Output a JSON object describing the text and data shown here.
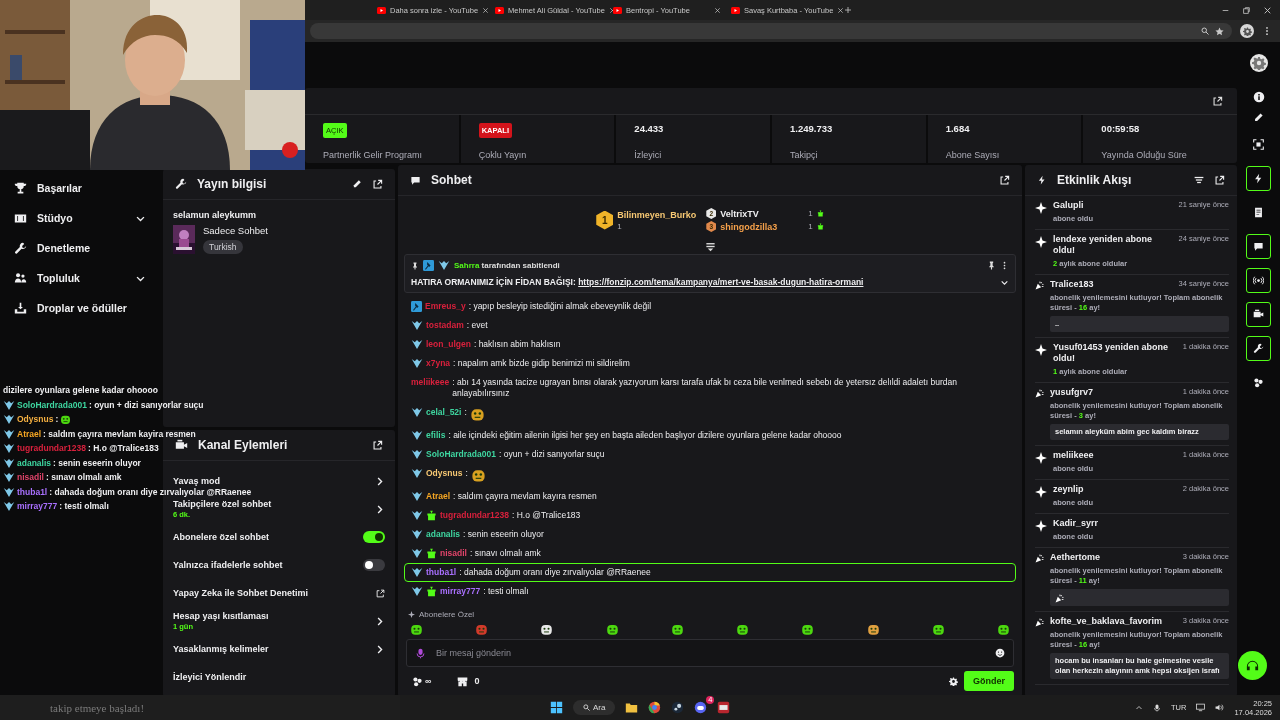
{
  "browser": {
    "tabs": [
      {
        "title": "Daha sonra izle - YouTube"
      },
      {
        "title": "Mehmet Ali Güldal - YouTube"
      },
      {
        "title": "Bentropi - YouTube"
      },
      {
        "title": "Savaş Kurtbaba - YouTube"
      }
    ]
  },
  "stats": {
    "cells": [
      {
        "kind": "badge",
        "badge": "AÇIK",
        "on": true,
        "label": "Partnerlik Gelir Programı"
      },
      {
        "kind": "badge",
        "badge": "KAPALI",
        "on": false,
        "label": "Çoklu Yayın"
      },
      {
        "kind": "value",
        "value": "24.433",
        "label": "İzleyici"
      },
      {
        "kind": "value",
        "value": "1.249.733",
        "label": "Takipçi"
      },
      {
        "kind": "value",
        "value": "1.684",
        "label": "Abone Sayısı"
      },
      {
        "kind": "value",
        "value": "00:59:58",
        "label": "Yayında Olduğu Süre"
      }
    ]
  },
  "sidebar": {
    "items": [
      {
        "label": "Başarılar",
        "expandable": false
      },
      {
        "label": "Stüdyo",
        "expandable": true
      },
      {
        "label": "Denetleme",
        "expandable": false
      },
      {
        "label": "Topluluk",
        "expandable": true
      },
      {
        "label": "Droplar ve ödüller",
        "expandable": false
      }
    ]
  },
  "stream_info": {
    "title": "Yayın bilgisi",
    "stream_title": "selamun aleykumm",
    "category": "Sadece Sohbet",
    "tags": [
      "Turkish"
    ]
  },
  "channel_actions": {
    "title": "Kanal Eylemleri",
    "items": [
      {
        "kind": "arrow",
        "label": "Yavaş mod"
      },
      {
        "kind": "arrow",
        "label": "Takipçilere özel sohbet",
        "value": "6 dk."
      },
      {
        "kind": "toggle",
        "label": "Abonelere özel sohbet",
        "on": true
      },
      {
        "kind": "toggle",
        "label": "Yalnızca ifadelerle sohbet",
        "on": false
      },
      {
        "kind": "external",
        "label": "Yapay Zeka ile Sohbet Denetimi"
      },
      {
        "kind": "arrow",
        "label": "Hesap yaşı kısıtlaması",
        "value": "1 gün"
      },
      {
        "kind": "arrow",
        "label": "Yasaklanmış kelimeler"
      },
      {
        "kind": "plain",
        "label": "İzleyici Yönlendir"
      }
    ]
  },
  "chat": {
    "title": "Sohbet",
    "separator": ":",
    "leaderboard": [
      {
        "rank": "1",
        "name": "Bilinmeyen_Burko",
        "count": "1"
      },
      {
        "rank": "2",
        "name": "VeltrixTV",
        "count": "1"
      },
      {
        "rank": "3",
        "name": "shingodzilla3",
        "count": "1"
      }
    ],
    "pinned": {
      "pinned_by": "Sahrra",
      "note": "tarafından sabitlendi",
      "text": "HATIRA ORMANIMIZ İÇİN FİDAN BAĞIŞI:",
      "link": "https://fonzip.com/tema/kampanya/mert-ve-basak-dugun-hatira-ormani"
    },
    "messages": [
      {
        "kind": "text",
        "moderator": true,
        "subscriber": false,
        "gifter": false,
        "user": "Emreus_y",
        "color": "#d8203c",
        "text": "yapıp besleyip istediğini almak ebeveynlik değil",
        "highlighted": false
      },
      {
        "kind": "text",
        "moderator": false,
        "subscriber": true,
        "gifter": false,
        "user": "tostadam",
        "color": "#d8203c",
        "text": "evet",
        "highlighted": false
      },
      {
        "kind": "text",
        "moderator": false,
        "subscriber": true,
        "gifter": false,
        "user": "leon_ulgen",
        "color": "#d8203c",
        "text": "haklısın abim haklısın",
        "highlighted": false
      },
      {
        "kind": "text",
        "moderator": false,
        "subscriber": true,
        "gifter": false,
        "user": "x7yna",
        "color": "#d8203c",
        "text": "napalım amk bizde gidip benimizi mi sildirelim",
        "highlighted": false
      },
      {
        "kind": "text",
        "moderator": false,
        "subscriber": false,
        "gifter": false,
        "user": "meliikeee",
        "color": "#d8203c",
        "text": "abı 14 yasında tacize ugrayan bınsı olarak yazıyorum karsı tarafa ufak bı ceza bile venlmedı sebebı de yetersız delıldi adaletı burdan anlayabılırsınız",
        "highlighted": false
      },
      {
        "kind": "emote",
        "moderator": false,
        "subscriber": true,
        "gifter": false,
        "user": "celal_52i",
        "color": "#3ed6a0",
        "highlighted": false
      },
      {
        "kind": "text",
        "moderator": false,
        "subscriber": true,
        "gifter": false,
        "user": "efilis",
        "color": "#3ed6a0",
        "text": "aile içindeki eğitim ailenin ilgisi her şey en başta aileden başlıyor dizilere oyunlara gelene kadar ohoooo",
        "highlighted": false
      },
      {
        "kind": "text",
        "moderator": false,
        "subscriber": true,
        "gifter": false,
        "user": "SoloHardrada001",
        "color": "#3ed6a0",
        "text": "oyun + dizi sanıyorlar suçu",
        "highlighted": false
      },
      {
        "kind": "emote",
        "moderator": false,
        "subscriber": true,
        "gifter": false,
        "user": "Odysnus",
        "color": "#f7c873",
        "highlighted": false
      },
      {
        "kind": "text",
        "moderator": false,
        "subscriber": true,
        "gifter": false,
        "user": "Atrael",
        "color": "#f5a623",
        "text": "saldım çayıra mevlam kayıra resmen",
        "highlighted": false
      },
      {
        "kind": "text",
        "moderator": false,
        "subscriber": true,
        "gifter": true,
        "user": "tugradundar1238",
        "color": "#d8203c",
        "text": "H.o @Tralice183",
        "highlighted": false
      },
      {
        "kind": "text",
        "moderator": false,
        "subscriber": true,
        "gifter": false,
        "user": "adanalis",
        "color": "#3ed6a0",
        "text": "senin eseerin oluyor",
        "highlighted": false
      },
      {
        "kind": "text",
        "moderator": false,
        "subscriber": true,
        "gifter": true,
        "user": "nisadil",
        "color": "#e0446a",
        "text": "sınavı olmalı amk",
        "highlighted": false
      },
      {
        "kind": "text",
        "moderator": false,
        "subscriber": true,
        "gifter": false,
        "user": "thuba1l",
        "color": "#a970ff",
        "text": "dahada doğum oranı diye zırvalıyolar @RRaenee",
        "highlighted": true
      },
      {
        "kind": "text",
        "moderator": false,
        "subscriber": true,
        "gifter": true,
        "user": "mirray777",
        "color": "#a970ff",
        "text": "testi olmalı",
        "highlighted": false
      }
    ],
    "emote_section": "Abonelere Özel",
    "emotes": [
      {
        "color": "#4cd80f"
      },
      {
        "color": "#d23a2a"
      },
      {
        "color": "#e8e8e8"
      },
      {
        "color": "#4cd80f"
      },
      {
        "color": "#4cd80f"
      },
      {
        "color": "#4cd80f"
      },
      {
        "color": "#4cd80f"
      },
      {
        "color": "#e0a040"
      },
      {
        "color": "#4cd80f"
      },
      {
        "color": "#4cd80f"
      }
    ],
    "input": {
      "placeholder": "Bir mesaj gönderin"
    },
    "points": "∞",
    "redeems": "0",
    "send_button": "Gönder"
  },
  "activity": {
    "title": "Etkinlik Akışı",
    "events": [
      {
        "kind": "sub",
        "title": "Galupli",
        "time": "21 saniye önce",
        "detail": "abone oldu"
      },
      {
        "kind": "sub",
        "title": "lendexe yeniden abone oldu!",
        "time": "24 saniye önce",
        "count": "2",
        "detail": "aylık abone oldular"
      },
      {
        "kind": "resub",
        "title": "Tralice183",
        "time": "34 saniye önce",
        "detail": "abonelik yenilemesini kutluyor! Toplam abonelik süresi -",
        "count": "16",
        "unit": "ay!",
        "message": {
          "kind": "text",
          "text": ".."
        }
      },
      {
        "kind": "sub",
        "title": "Yusuf01453 yeniden abone oldu!",
        "time": "1 dakika önce",
        "count": "1",
        "detail": "aylık abone oldular"
      },
      {
        "kind": "resub",
        "title": "yusufgrv7",
        "time": "1 dakika önce",
        "detail": "abonelik yenilemesini kutluyor! Toplam abonelik süresi -",
        "count": "3",
        "unit": "ay!",
        "message": {
          "kind": "text",
          "text": "selamın aleyküm abim gec kaldım birazz"
        }
      },
      {
        "kind": "sub",
        "title": "meliikeee",
        "time": "1 dakika önce",
        "detail": "abone oldu"
      },
      {
        "kind": "sub",
        "title": "zeynlip",
        "time": "2 dakika önce",
        "detail": "abone oldu"
      },
      {
        "kind": "sub",
        "title": "Kadir_syrr",
        "detail": "abone oldu"
      },
      {
        "kind": "resub",
        "title": "Aethertome",
        "time": "3 dakika önce",
        "detail": "abonelik yenilemesini kutluyor! Toplam abonelik süresi -",
        "count": "11",
        "unit": "ay!",
        "message": {
          "kind": "emote"
        }
      },
      {
        "kind": "resub",
        "title": "kofte_ve_baklava_favorim",
        "time": "3 dakika önce",
        "detail": "abonelik yenilemesini kutluyor! Toplam abonelik süresi -",
        "count": "16",
        "unit": "ay!",
        "message": {
          "kind": "text",
          "text": "hocam bu insanları bu hale gelmesine vesile olan herkezin alayının amk hepsi oksijen israfı"
        }
      }
    ]
  },
  "rail": [
    {
      "active": false
    },
    {
      "active": true
    },
    {
      "active": false
    },
    {
      "active": true
    },
    {
      "active": true
    },
    {
      "active": true
    },
    {
      "active": true
    },
    {
      "active": false
    }
  ],
  "overlay_chat": {
    "separator": ":",
    "lines": [
      {
        "kind": "cont",
        "text": "dizilere oyunlara gelene kadar ohoooo"
      },
      {
        "kind": "text",
        "user": "SoloHardrada001",
        "color": "#3ed6a0",
        "text": "oyun + dizi sanıyorlar suçu"
      },
      {
        "kind": "emote",
        "user": "Odysnus",
        "color": "#f5b041"
      },
      {
        "kind": "text",
        "user": "Atrael",
        "color": "#f5a623",
        "text": "saldım çayıra mevlam kayira resmen"
      },
      {
        "kind": "text",
        "user": "tugradundar1238",
        "color": "#d8203c",
        "text": "H.o @Tralice183"
      },
      {
        "kind": "text",
        "user": "adanalis",
        "color": "#3ed6a0",
        "text": "senin eseerin oluyor"
      },
      {
        "kind": "text",
        "user": "nisadil",
        "color": "#e0446a",
        "text": "sınavı olmalı amk"
      },
      {
        "kind": "text",
        "user": "thuba1l",
        "color": "#a970ff",
        "text": "dahada doğum oranı diye zırvalıyolar @RRaenee"
      },
      {
        "kind": "text",
        "user": "mirray777",
        "color": "#a970ff",
        "text": "testi olmalı"
      }
    ]
  },
  "alert": {
    "text": "takip etmeye başladı!"
  },
  "taskbar": {
    "search": "Ara",
    "badge": "4",
    "lang": "TUR",
    "time": "20:25",
    "date": "17.04.2026"
  }
}
